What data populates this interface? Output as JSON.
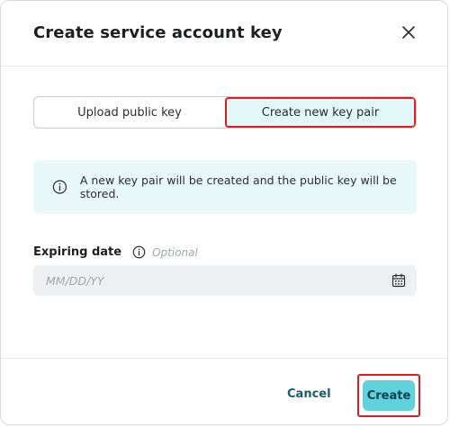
{
  "dialog": {
    "title": "Create service account key",
    "close_icon": "close-icon"
  },
  "key_source": {
    "options": [
      {
        "label": "Upload public key",
        "selected": false
      },
      {
        "label": "Create new key pair",
        "selected": true
      }
    ]
  },
  "info_banner": {
    "icon": "info-icon",
    "text": "A new key pair will be created and the public key will be stored."
  },
  "expiring_date": {
    "label": "Expiring date",
    "info_icon": "info-icon",
    "optional_text": "Optional",
    "value": "",
    "placeholder": "MM/DD/YY",
    "calendar_icon": "calendar-icon"
  },
  "footer": {
    "cancel_label": "Cancel",
    "create_label": "Create"
  },
  "colors": {
    "accent": "#5fd2dc",
    "selected_bg": "#e2f7f8",
    "info_bg": "#e9f8f9",
    "highlight": "#e01b24",
    "link": "#1e5a6d"
  }
}
